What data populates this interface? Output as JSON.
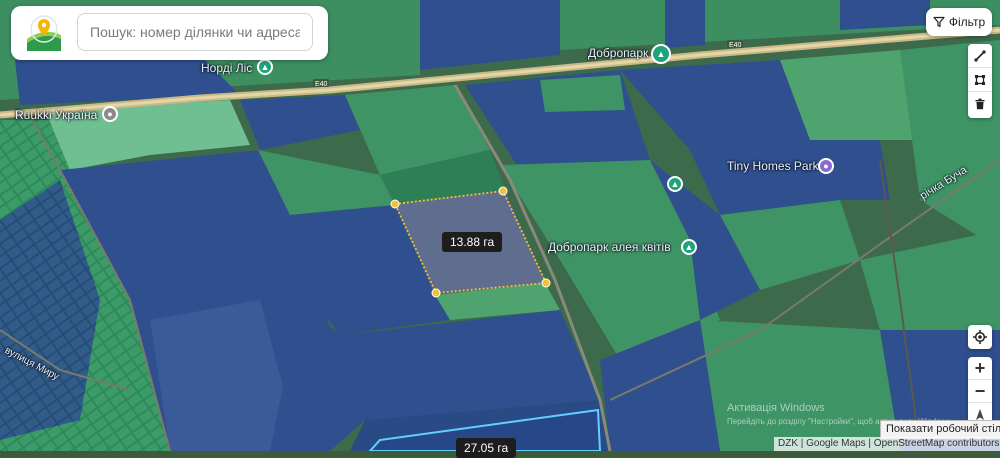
{
  "search": {
    "placeholder": "Пошук: номер ділянки чи адреса"
  },
  "filter": {
    "label": "Фільтр",
    "icon": "filter-icon"
  },
  "tools": [
    {
      "name": "measure-line-icon"
    },
    {
      "name": "measure-area-icon"
    },
    {
      "name": "trash-icon"
    }
  ],
  "zoom": {
    "in": "+",
    "out": "−"
  },
  "selection": {
    "area": "13.88 га"
  },
  "second_parcel": {
    "area": "27.05 га"
  },
  "map_labels": {
    "nordi_lis": "Норді Ліс",
    "dobropark": "Добропарк",
    "ruukki": "Ruukki Україна",
    "tiny_homes": "Tiny Homes Park",
    "dobropark_alley": "Добропарк алея квітів",
    "river": "річка Буча",
    "street": "вулиця Миру",
    "road_e40_a": "E40",
    "road_e40_b": "E40"
  },
  "windows_watermark": {
    "title": "Активація Windows",
    "sub": "Перейдіть до розділу \"Настройки\", щоб активувати Windows."
  },
  "desktop_tip": "Показати робочий стіл",
  "attribution": "DZK | Google Maps | OpenStreetMap contributors",
  "colors": {
    "parcel_blue": "#2f4f8f",
    "parcel_green": "#3f9466",
    "selection_border": "#f1c232",
    "highlight_border": "#5fd0ff"
  }
}
